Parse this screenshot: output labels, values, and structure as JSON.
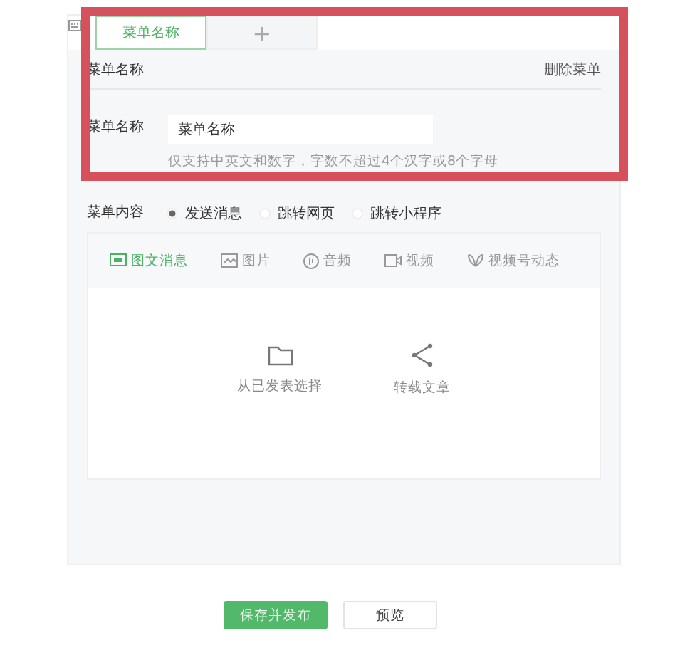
{
  "menu_tabs": [
    {
      "label": "菜单名称",
      "kind": "text",
      "selected": true
    },
    {
      "label": "+",
      "kind": "add",
      "selected": false
    }
  ],
  "editor": {
    "title": "菜单名称",
    "delete_link": "删除菜单",
    "name_field": {
      "label": "菜单名称",
      "value": "菜单名称",
      "hint": "仅支持中英文和数字，字数不超过4个汉字或8个字母"
    },
    "content": {
      "label": "菜单内容",
      "options": [
        {
          "label": "发送消息",
          "selected": true
        },
        {
          "label": "跳转网页",
          "selected": false
        },
        {
          "label": "跳转小程序",
          "selected": false
        }
      ],
      "message_types": [
        {
          "label": "图文消息",
          "kind": "article",
          "selected": true
        },
        {
          "label": "图片",
          "kind": "image",
          "selected": false
        },
        {
          "label": "音频",
          "kind": "audio",
          "selected": false
        },
        {
          "label": "视频",
          "kind": "video",
          "selected": false
        },
        {
          "label": "视频号动态",
          "kind": "channels",
          "selected": false
        }
      ],
      "actions": [
        {
          "label": "从已发表选择",
          "kind": "folder"
        },
        {
          "label": "转载文章",
          "kind": "share"
        }
      ]
    }
  },
  "buttons": [
    {
      "label": "保存并发布",
      "kind": "primary"
    },
    {
      "label": "预览",
      "kind": "default"
    }
  ]
}
